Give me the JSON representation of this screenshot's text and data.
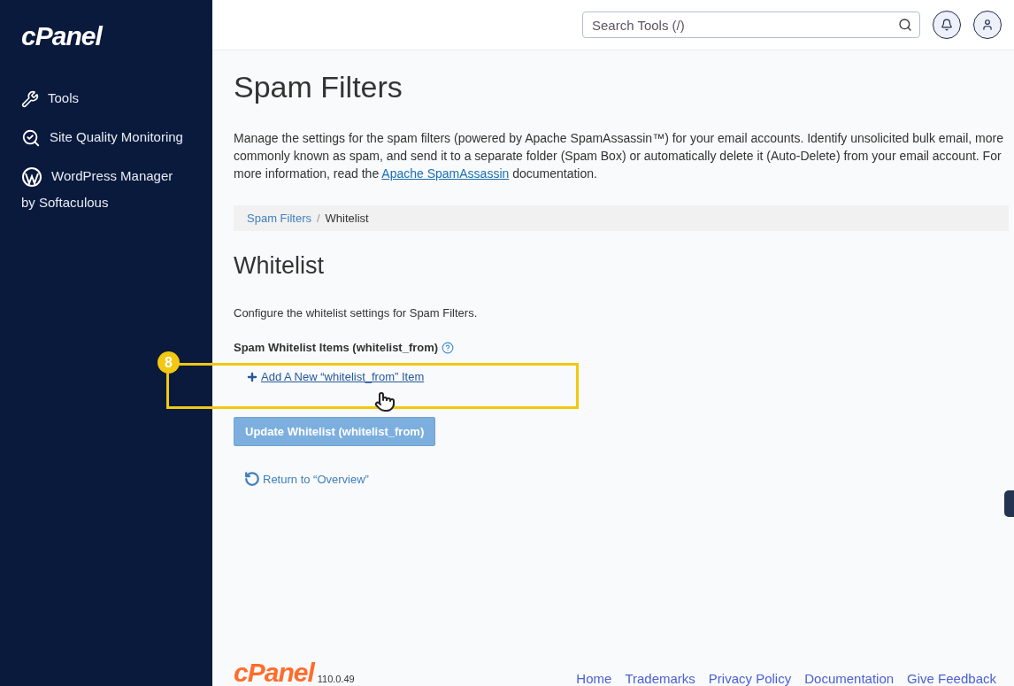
{
  "sidebar": {
    "logo": "cPanel",
    "items": [
      {
        "kind": "tools",
        "label": "Tools"
      },
      {
        "kind": "quality",
        "label": "Site Quality Monitoring"
      },
      {
        "kind": "wordpress",
        "label": "WordPress Manager by Softaculous"
      }
    ]
  },
  "topbar": {
    "search": {
      "placeholder": "Search Tools (/)"
    }
  },
  "page": {
    "title": "Spam Filters",
    "description_before": "Manage the settings for the spam filters (powered by Apache SpamAssassin™) for your email accounts. Identify unsolicited bulk email, more commonly known as spam, and send it to a separate folder (Spam Box) or automatically delete it (Auto-Delete) from your email account. For more information, read the ",
    "description_link": "Apache SpamAssassin",
    "description_after": " documentation.",
    "breadcrumb": [
      {
        "label": "Spam Filters",
        "link": true
      },
      {
        "label": "Whitelist",
        "link": false
      }
    ],
    "breadcrumb_separator": "/",
    "section_title": "Whitelist",
    "section_description": "Configure the whitelist settings for Spam Filters.",
    "items_label": "Spam Whitelist Items (whitelist_from)",
    "add_link": "Add A New “whitelist_from” Item",
    "update_button": {
      "label": "Update Whitelist (whitelist_from)",
      "disabled": true
    },
    "return_link": "Return to “Overview”"
  },
  "annotation": {
    "step": "8"
  },
  "footer": {
    "logo": "cPanel",
    "version": "110.0.49",
    "links": [
      "Home",
      "Trademarks",
      "Privacy Policy",
      "Documentation",
      "Give Feedback"
    ]
  }
}
